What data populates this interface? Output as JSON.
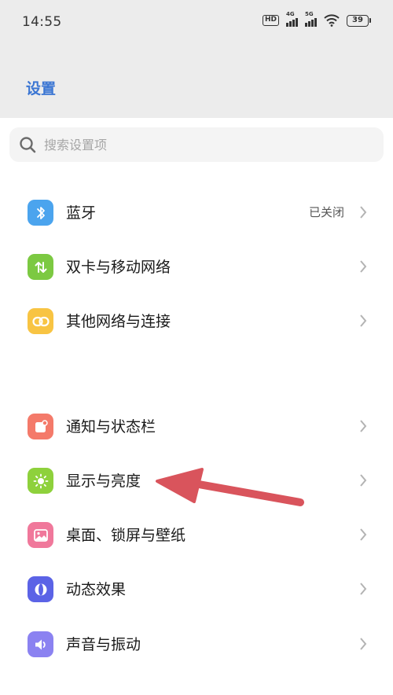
{
  "status_bar": {
    "time": "14:55",
    "hd_label": "HD",
    "signal_1_label": "4G",
    "signal_2_label": "5G",
    "battery_level": "39"
  },
  "header": {
    "title": "设置"
  },
  "search": {
    "placeholder": "搜索设置项"
  },
  "menu": {
    "bluetooth": {
      "label": "蓝牙",
      "value": "已关闭",
      "icon": "bluetooth-icon"
    },
    "sim": {
      "label": "双卡与移动网络",
      "icon": "mobile-data-icon"
    },
    "other_network": {
      "label": "其他网络与连接",
      "icon": "link-icon"
    },
    "notification": {
      "label": "通知与状态栏",
      "icon": "notification-icon"
    },
    "display": {
      "label": "显示与亮度",
      "icon": "brightness-icon"
    },
    "wallpaper": {
      "label": "桌面、锁屏与壁纸",
      "icon": "wallpaper-icon"
    },
    "effects": {
      "label": "动态效果",
      "icon": "motion-effect-icon"
    },
    "sound": {
      "label": "声音与振动",
      "icon": "sound-icon"
    }
  },
  "colors": {
    "title": "#3b76d3",
    "bluetooth": "#4ba4ee",
    "sim": "#7cc942",
    "other_network": "#f8c443",
    "notification": "#f47a6a",
    "display": "#8ed13c",
    "wallpaper": "#f0789b",
    "effects": "#5b63e6",
    "sound": "#8b82f1",
    "annotation_arrow": "#d9545c"
  }
}
